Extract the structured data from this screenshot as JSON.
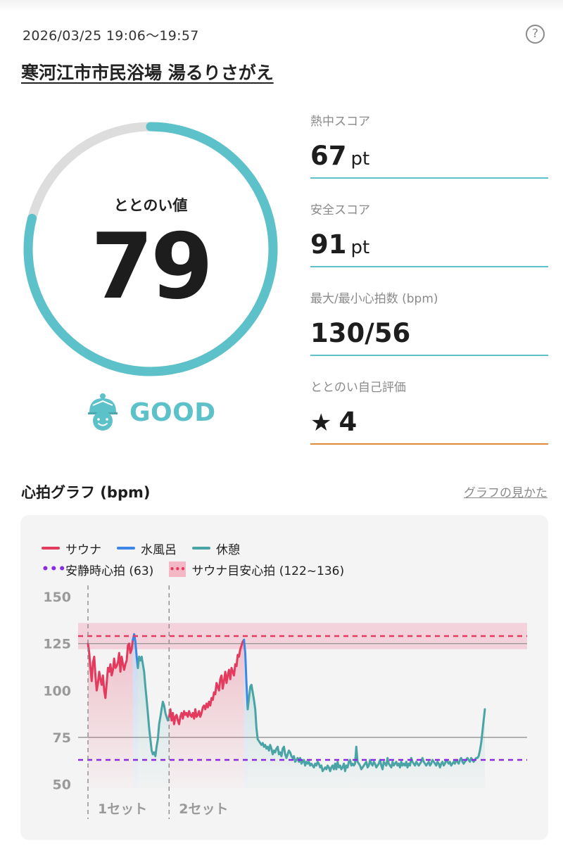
{
  "session": {
    "datetime": "2026/03/25 19:06～19:57",
    "help_icon": "question-circle-icon",
    "facility": "寒河江市市民浴場 湯るりさがえ"
  },
  "totonoi": {
    "label": "ととのい値",
    "value": "79",
    "progress": 0.79,
    "rating": "GOOD",
    "rating_icon": "sauna-hat-face-icon",
    "colors": {
      "accent": "#5cc1c8",
      "track": "#dddddd"
    }
  },
  "stats": [
    {
      "label": "熱中スコア",
      "value": "67",
      "unit": "pt"
    },
    {
      "label": "安全スコア",
      "value": "91",
      "unit": "pt"
    },
    {
      "label": "最大/最小心拍数 (bpm)",
      "value": "130/56",
      "unit": ""
    },
    {
      "label": "ととのい自己評価",
      "star": "★",
      "value": "4",
      "unit": ""
    }
  ],
  "graph": {
    "title": "心拍グラフ (bpm)",
    "guide_link": "グラフの見かた",
    "legend": {
      "sauna": "サウナ",
      "water_bath": "水風呂",
      "rest": "休憩",
      "resting_hr": "安静時心拍 (63)",
      "sauna_target": "サウナ目安心拍 (122~136)"
    },
    "set_labels": [
      "1セット",
      "2セット"
    ]
  },
  "chart_data": {
    "type": "line",
    "ylabel": "",
    "ylim": [
      48,
      153
    ],
    "yticks": [
      50,
      75,
      100,
      125,
      150
    ],
    "reference_lines": {
      "resting_hr": 63,
      "target_low": 122,
      "target_high": 136,
      "target_dashed": 129
    },
    "colors": {
      "sauna": "#e33a5e",
      "water_bath": "#3b86e6",
      "rest": "#4aa3a5",
      "resting": "#8a2be2",
      "band": "#f3b7c6",
      "grid": "#9a9a9a"
    },
    "series": [
      {
        "name": "サウナ",
        "x": [
          0,
          1,
          2,
          3,
          4,
          5,
          6,
          7,
          8,
          9,
          10,
          11,
          12,
          13,
          14,
          15,
          16,
          17,
          18,
          19,
          20,
          21,
          22,
          23,
          24,
          25,
          26,
          27,
          28,
          29,
          30,
          31,
          32,
          33,
          34,
          35,
          36
        ],
        "values": [
          125,
          120,
          112,
          105,
          115,
          118,
          108,
          100,
          104,
          110,
          106,
          103,
          108,
          100,
          96,
          104,
          112,
          110,
          114,
          108,
          111,
          117,
          112,
          113,
          115,
          120,
          110,
          118,
          114,
          111,
          114,
          116,
          124,
          125,
          120,
          122,
          127
        ]
      },
      {
        "name": "水風呂",
        "x": [
          36,
          37,
          38,
          39,
          40
        ],
        "values": [
          127,
          130,
          126,
          118,
          112
        ]
      },
      {
        "name": "休憩",
        "x": [
          40,
          41,
          42,
          43,
          44,
          45,
          46,
          47,
          48,
          49,
          50,
          51,
          52,
          53,
          54,
          55,
          56,
          57,
          58,
          59,
          60,
          61,
          62,
          63,
          64,
          65
        ],
        "values": [
          112,
          118,
          116,
          118,
          114,
          110,
          102,
          95,
          88,
          80,
          74,
          68,
          66,
          67,
          65,
          70,
          74,
          82,
          86,
          90,
          94,
          92,
          88,
          86,
          84,
          86
        ]
      },
      {
        "name": "サウナ",
        "x": [
          65,
          66,
          67,
          68,
          69,
          70,
          71,
          72,
          73,
          74,
          75,
          76,
          77,
          78,
          79,
          80,
          81,
          82,
          83,
          84,
          85,
          86,
          87,
          88,
          89,
          90,
          91,
          92,
          93,
          94,
          95,
          96,
          97,
          98,
          99,
          100,
          101,
          102,
          103,
          104,
          105,
          106,
          107,
          108,
          109,
          110,
          111,
          112,
          113,
          114,
          115,
          116,
          117,
          118,
          119,
          120,
          121,
          122,
          123,
          124,
          125
        ],
        "values": [
          86,
          90,
          84,
          88,
          82,
          86,
          87,
          84,
          82,
          86,
          88,
          85,
          89,
          87,
          88,
          86,
          89,
          87,
          86,
          88,
          85,
          90,
          86,
          87,
          89,
          86,
          88,
          91,
          92,
          90,
          93,
          91,
          94,
          92,
          96,
          95,
          99,
          98,
          104,
          102,
          100,
          106,
          108,
          101,
          105,
          110,
          104,
          108,
          111,
          106,
          112,
          110,
          108,
          114,
          113,
          119,
          118,
          122,
          124,
          126,
          127
        ]
      },
      {
        "name": "水風呂",
        "x": [
          125,
          126,
          127,
          128
        ],
        "values": [
          127,
          120,
          104,
          90
        ]
      },
      {
        "name": "休憩",
        "x": [
          128,
          129,
          130,
          131,
          132,
          133,
          134,
          135,
          136,
          137,
          138,
          139,
          140,
          141,
          142,
          143,
          144,
          145,
          146,
          147,
          148,
          149,
          150,
          151,
          152,
          153,
          154,
          155,
          156,
          157,
          158,
          159,
          160,
          161,
          162,
          163,
          164,
          165,
          166,
          167,
          168,
          169,
          170,
          171,
          172,
          173,
          174,
          175,
          176,
          177,
          178,
          179,
          180,
          181,
          182,
          183,
          184,
          185,
          186,
          187,
          188,
          189,
          190,
          191,
          192,
          193,
          194,
          195,
          196,
          197,
          198,
          199,
          200,
          201,
          202,
          203,
          204,
          205,
          206,
          207,
          208,
          209,
          210,
          211,
          212,
          213,
          214,
          215,
          216,
          217,
          218,
          219,
          220,
          221,
          222,
          223,
          224,
          225,
          226,
          227,
          228,
          229,
          230,
          231,
          232,
          233,
          234,
          235,
          236,
          237,
          238,
          239,
          240,
          241,
          242,
          243,
          244,
          245,
          246,
          247,
          248,
          249,
          250,
          251,
          252,
          253,
          254,
          255,
          256,
          257,
          258,
          259,
          260,
          261,
          262,
          263,
          264,
          265,
          266,
          267,
          268,
          269,
          270,
          271,
          272,
          273,
          274,
          275,
          276,
          277,
          278,
          279,
          280,
          281,
          282,
          283,
          284,
          285,
          286,
          287,
          288,
          289,
          290,
          291,
          292,
          293,
          294,
          295,
          296,
          297,
          298,
          299,
          300,
          301,
          302,
          303,
          304,
          305,
          306,
          307,
          308,
          309,
          310,
          311,
          312,
          313,
          314,
          315,
          316,
          317,
          318
        ],
        "values": [
          90,
          96,
          102,
          103,
          99,
          95,
          90,
          80,
          74,
          73,
          72,
          71,
          72,
          70,
          71,
          69,
          70,
          68,
          71,
          69,
          66,
          68,
          67,
          69,
          70,
          66,
          67,
          65,
          69,
          70,
          66,
          64,
          66,
          68,
          67,
          65,
          64,
          65,
          62,
          63,
          64,
          62,
          64,
          61,
          62,
          63,
          60,
          62,
          61,
          62,
          60,
          61,
          60,
          59,
          61,
          60,
          62,
          61,
          59,
          60,
          57,
          58,
          59,
          58,
          60,
          59,
          57,
          59,
          60,
          58,
          61,
          58,
          62,
          59,
          60,
          58,
          59,
          61,
          57,
          60,
          59,
          62,
          63,
          60,
          61,
          60,
          61,
          70,
          62,
          61,
          60,
          58,
          59,
          60,
          61,
          62,
          59,
          60,
          63,
          61,
          60,
          62,
          61,
          59,
          60,
          61,
          63,
          60,
          58,
          62,
          61,
          60,
          64,
          61,
          60,
          59,
          62,
          60,
          61,
          62,
          60,
          61,
          59,
          62,
          60,
          61,
          60,
          62,
          59,
          61,
          60,
          64,
          62,
          61,
          60,
          62,
          61,
          60,
          61,
          62,
          64,
          62,
          61,
          60,
          61,
          62,
          60,
          61,
          63,
          62,
          61,
          60,
          62,
          61,
          59,
          61,
          62,
          60,
          61,
          63,
          62,
          61,
          62,
          60,
          61,
          62,
          61,
          63,
          62,
          61,
          63,
          64,
          62,
          61,
          62,
          63,
          64,
          63,
          62,
          64,
          63,
          62,
          63,
          64,
          64,
          65,
          68,
          72,
          78,
          84,
          90
        ]
      }
    ]
  }
}
